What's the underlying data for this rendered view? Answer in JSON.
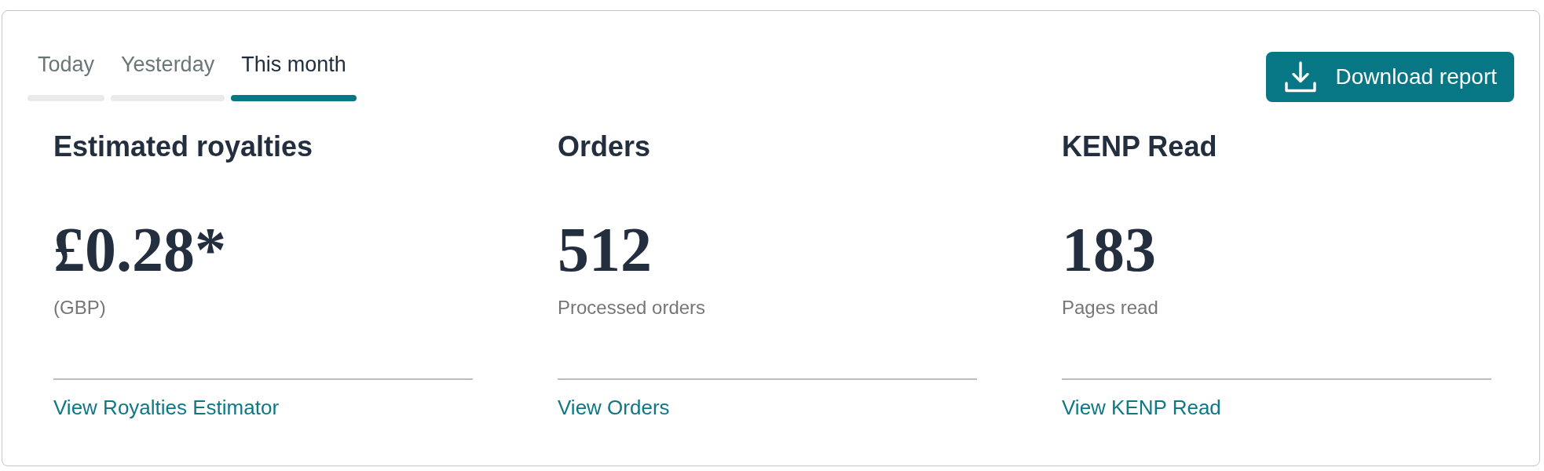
{
  "tabs": [
    {
      "label": "Today",
      "selected": false
    },
    {
      "label": "Yesterday",
      "selected": false
    },
    {
      "label": "This month",
      "selected": true
    }
  ],
  "download_button": {
    "label": "Download report"
  },
  "metrics": [
    {
      "title": "Estimated royalties",
      "value": "£0.28*",
      "caption": "(GBP)",
      "link": "View Royalties Estimator"
    },
    {
      "title": "Orders",
      "value": "512",
      "caption": "Processed orders",
      "link": "View Orders"
    },
    {
      "title": "KENP Read",
      "value": "183",
      "caption": "Pages read",
      "link": "View KENP Read"
    }
  ]
}
